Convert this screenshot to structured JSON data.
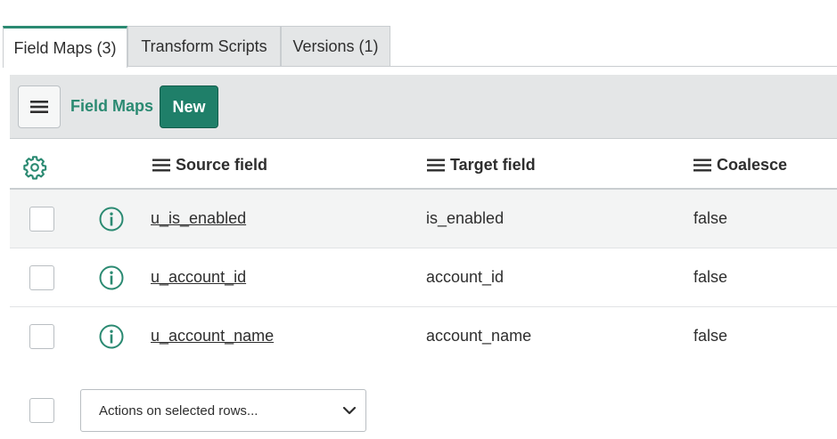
{
  "tabs": [
    {
      "label": "Field Maps (3)",
      "active": true
    },
    {
      "label": "Transform Scripts",
      "active": false
    },
    {
      "label": "Versions (1)",
      "active": false
    }
  ],
  "toolbar": {
    "menu_icon": "hamburger-icon",
    "title": "Field Maps",
    "new_label": "New"
  },
  "table": {
    "settings_icon": "gear-icon",
    "columns": [
      "Source field",
      "Target field",
      "Coalesce"
    ],
    "rows": [
      {
        "source": "u_is_enabled",
        "target": "is_enabled",
        "coalesce": "false"
      },
      {
        "source": "u_account_id",
        "target": "account_id",
        "coalesce": "false"
      },
      {
        "source": "u_account_name",
        "target": "account_name",
        "coalesce": "false"
      }
    ]
  },
  "footer": {
    "actions_label": "Actions on selected rows...",
    "dropdown_icon": "chevron-down-icon"
  },
  "colors": {
    "accent": "#2b8a72",
    "button": "#1f7f69"
  }
}
